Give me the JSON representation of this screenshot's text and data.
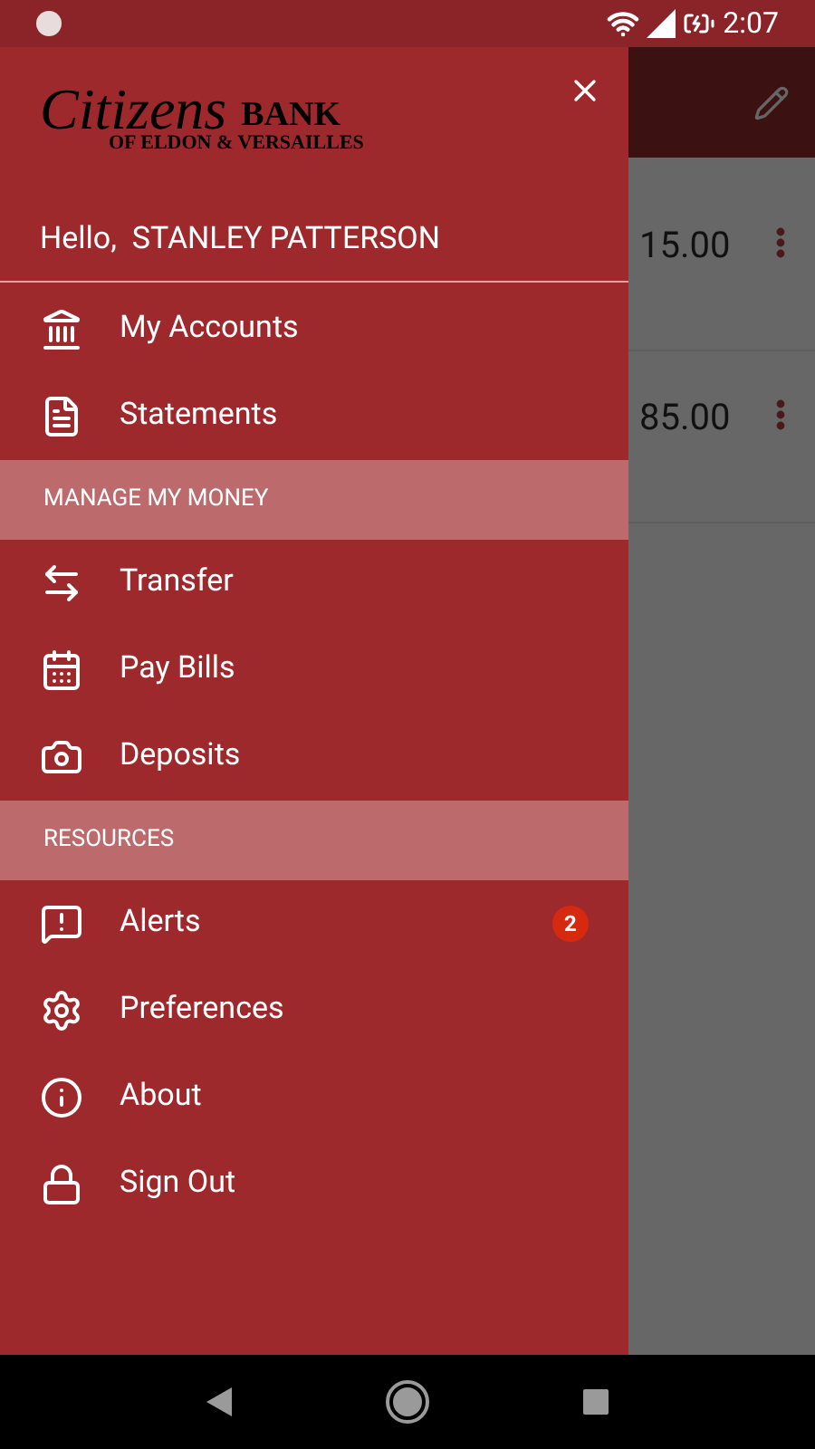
{
  "status_bar": {
    "time": "2:07"
  },
  "background": {
    "rows": [
      {
        "amount": "15.00"
      },
      {
        "amount": "85.00"
      }
    ]
  },
  "drawer": {
    "logo": {
      "script": "Citizens",
      "word": "BANK",
      "subtitle": "OF ELDON & VERSAILLES"
    },
    "greeting": "Hello,  STANLEY PATTERSON",
    "items": [
      {
        "kind": "item",
        "label": "My Accounts"
      },
      {
        "kind": "item",
        "label": "Statements"
      },
      {
        "kind": "section",
        "label": "MANAGE MY MONEY"
      },
      {
        "kind": "item",
        "label": "Transfer"
      },
      {
        "kind": "item",
        "label": "Pay Bills"
      },
      {
        "kind": "item",
        "label": "Deposits"
      },
      {
        "kind": "section",
        "label": "RESOURCES"
      },
      {
        "kind": "item",
        "label": "Alerts",
        "badge": "2"
      },
      {
        "kind": "item",
        "label": "Preferences"
      },
      {
        "kind": "item",
        "label": "About"
      },
      {
        "kind": "item",
        "label": "Sign Out"
      }
    ]
  }
}
